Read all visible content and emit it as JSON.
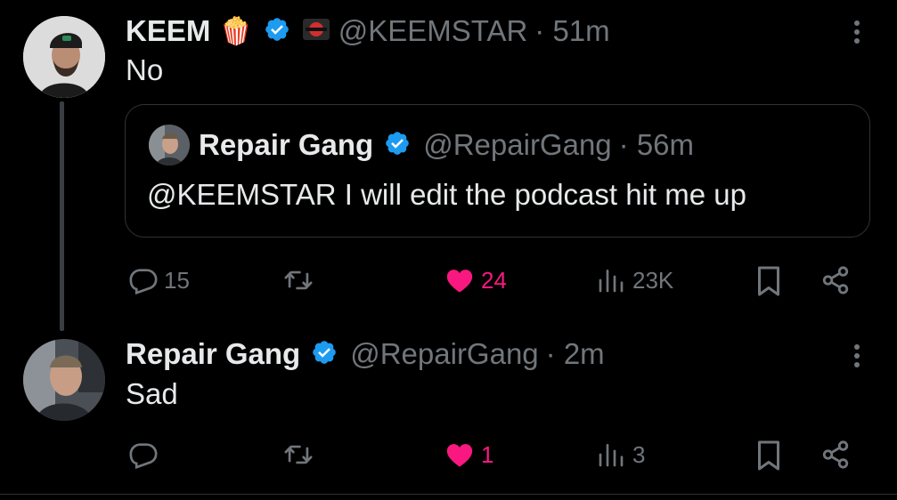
{
  "tweet1": {
    "name": "KEEM",
    "emoji": "🍿",
    "handle": "@KEEMSTAR",
    "time": "· 51m",
    "text": "No",
    "quote": {
      "name": "Repair Gang",
      "handle": "@RepairGang",
      "time": "· 56m",
      "text": "@KEEMSTAR I will edit the podcast hit me up"
    },
    "actions": {
      "replies": "15",
      "retweets": "",
      "likes": "24",
      "views": "23K"
    }
  },
  "tweet2": {
    "name": "Repair Gang",
    "handle": "@RepairGang",
    "time": "· 2m",
    "text": "Sad",
    "actions": {
      "replies": "",
      "retweets": "",
      "likes": "1",
      "views": "3"
    }
  },
  "colors": {
    "background": "#000000",
    "text": "#e7e9ea",
    "muted": "#71767b",
    "verified": "#1d9bf0",
    "like": "#f91880",
    "border": "#2f3336"
  },
  "icons": [
    "verified-badge-icon",
    "reply-icon",
    "retweet-icon",
    "heart-icon",
    "views-icon",
    "bookmark-icon",
    "share-icon",
    "more-icon"
  ]
}
